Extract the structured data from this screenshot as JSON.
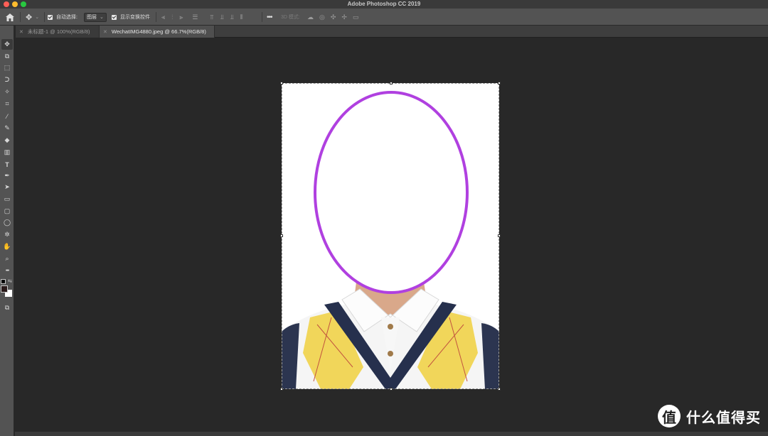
{
  "app": {
    "title": "Adobe Photoshop CC 2019"
  },
  "options": {
    "auto_select_label": "自动选择:",
    "auto_select_value": "图层",
    "show_transform_label": "显示变换控件",
    "mode_3d_label": "3D 模式:"
  },
  "tabs": [
    {
      "label": "未标题-1 @ 100%(RGB/8)",
      "active": false
    },
    {
      "label": "WechatIMG4880.jpeg @ 66.7%(RGB/8)",
      "active": true
    }
  ],
  "tools": [
    {
      "name": "move-tool",
      "icon": "move-icon",
      "glyph": "✥"
    },
    {
      "name": "artboard-tool",
      "icon": "artboard-icon",
      "glyph": "⧉"
    },
    {
      "name": "marquee-tool",
      "icon": "rect-marquee-icon",
      "glyph": "⬚"
    },
    {
      "name": "lasso-tool",
      "icon": "lasso-icon",
      "glyph": "ᑐ"
    },
    {
      "name": "magic-wand-tool",
      "icon": "magic-wand-icon",
      "glyph": "✧"
    },
    {
      "name": "crop-tool",
      "icon": "crop-icon",
      "glyph": "⌗"
    },
    {
      "name": "eyedropper-tool",
      "icon": "eyedropper-icon",
      "glyph": "⁄"
    },
    {
      "name": "brush-tool",
      "icon": "brush-icon",
      "glyph": "✎"
    },
    {
      "name": "eraser-tool",
      "icon": "eraser-icon",
      "glyph": "◆"
    },
    {
      "name": "gradient-tool",
      "icon": "gradient-icon",
      "glyph": "▥"
    },
    {
      "name": "type-tool",
      "icon": "type-icon",
      "glyph": "T"
    },
    {
      "name": "pen-tool",
      "icon": "pen-icon",
      "glyph": "✒"
    },
    {
      "name": "path-select-tool",
      "icon": "path-select-icon",
      "glyph": "➤"
    },
    {
      "name": "rectangle-tool",
      "icon": "rectangle-icon",
      "glyph": "▭"
    },
    {
      "name": "rounded-rect-tool",
      "icon": "rounded-rect-icon",
      "glyph": "▢"
    },
    {
      "name": "ellipse-tool",
      "icon": "ellipse-icon",
      "glyph": "◯"
    },
    {
      "name": "custom-shape-tool",
      "icon": "custom-shape-icon",
      "glyph": "✲"
    },
    {
      "name": "hand-tool",
      "icon": "hand-icon",
      "glyph": "✋"
    },
    {
      "name": "zoom-tool",
      "icon": "zoom-icon",
      "glyph": "⌕"
    },
    {
      "name": "more-tools",
      "icon": "more-icon",
      "glyph": "•••"
    }
  ],
  "watermark": {
    "text": "什么值得买",
    "logo": "值"
  },
  "colors": {
    "outline": "#b040e0",
    "accent": "#535353"
  }
}
